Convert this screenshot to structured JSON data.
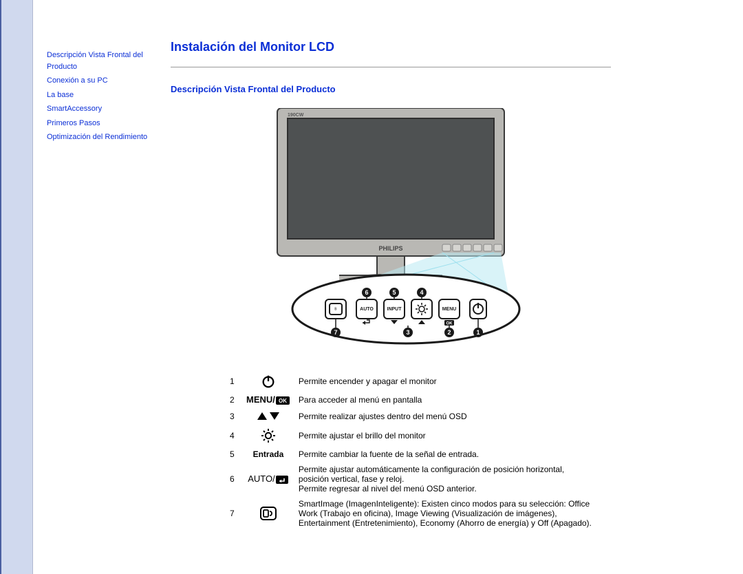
{
  "page_title": "Instalación del Monitor LCD",
  "section_title": "Descripción Vista Frontal del Producto",
  "sidebar": {
    "items": [
      {
        "label": "Descripción Vista Frontal del Producto"
      },
      {
        "label": "Conexión a su PC"
      },
      {
        "label": "La base"
      },
      {
        "label": "SmartAccessory"
      },
      {
        "label": "Primeros Pasos"
      },
      {
        "label": "Optimización del Rendimiento"
      }
    ]
  },
  "rows": [
    {
      "n": "1",
      "icon": "power-icon",
      "icon_text": "",
      "text": "Permite encender y apagar el monitor"
    },
    {
      "n": "2",
      "icon": "menu-ok-icon",
      "icon_text": "MENU/",
      "text": "Para acceder al menú en pantalla"
    },
    {
      "n": "3",
      "icon": "up-down-icon",
      "icon_text": "",
      "text": "Permite realizar ajustes dentro del menú OSD"
    },
    {
      "n": "4",
      "icon": "brightness-icon",
      "icon_text": "",
      "text": "Permite ajustar el brillo del monitor"
    },
    {
      "n": "5",
      "icon": "text-only",
      "icon_text": "Entrada",
      "text": "Permite cambiar la fuente de la señal de entrada."
    },
    {
      "n": "6",
      "icon": "auto-return-icon",
      "icon_text": "AUTO/",
      "text": "Permite ajustar automáticamente la configuración de posición horizontal, posición vertical, fase y reloj.\nPermite regresar al nivel del menú OSD anterior."
    },
    {
      "n": "7",
      "icon": "smartimage-icon",
      "icon_text": "",
      "text": "SmartImage (ImagenInteligente): Existen cinco modos para su selección: Office Work (Trabajo en oficina), Image Viewing (Visualización de imágenes), Entertainment (Entretenimiento), Economy (Ahorro de energía) y Off (Apagado)."
    }
  ],
  "monitor": {
    "brand": "PHILIPS",
    "button_labels": {
      "smartimage": "",
      "auto": "AUTO",
      "input": "INPUT",
      "brightness": "",
      "menu": "MENU",
      "power": ""
    },
    "callouts_top": [
      "6",
      "5",
      "4"
    ],
    "callouts_bottom": [
      "7",
      "3",
      "2",
      "1"
    ]
  }
}
